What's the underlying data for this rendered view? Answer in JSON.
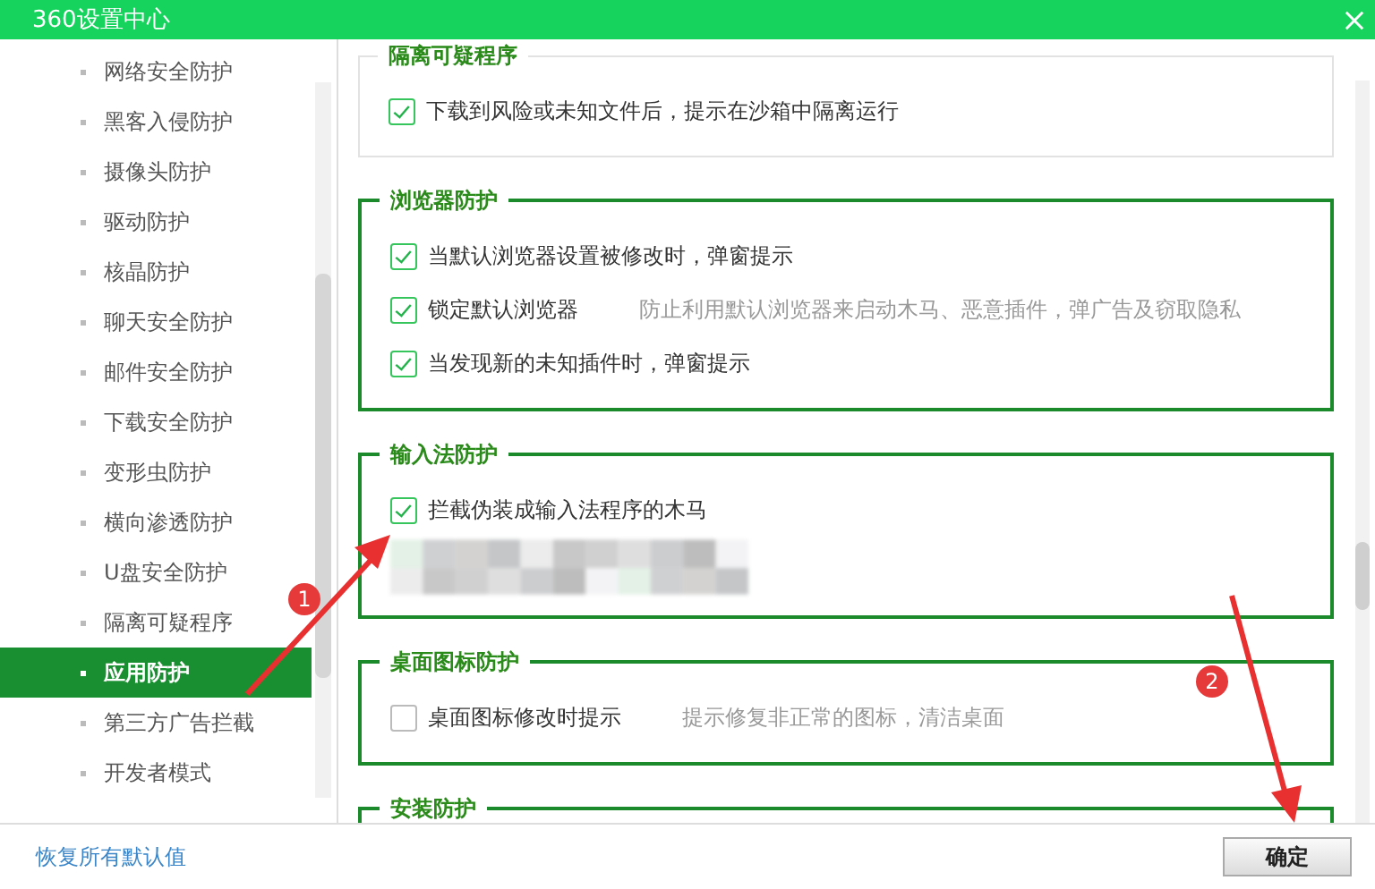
{
  "window": {
    "title": "360设置中心"
  },
  "sidebar": {
    "items": [
      {
        "label": "网络安全防护",
        "selected": false
      },
      {
        "label": "黑客入侵防护",
        "selected": false
      },
      {
        "label": "摄像头防护",
        "selected": false
      },
      {
        "label": "驱动防护",
        "selected": false
      },
      {
        "label": "核晶防护",
        "selected": false
      },
      {
        "label": "聊天安全防护",
        "selected": false
      },
      {
        "label": "邮件安全防护",
        "selected": false
      },
      {
        "label": "下载安全防护",
        "selected": false
      },
      {
        "label": "变形虫防护",
        "selected": false
      },
      {
        "label": "横向渗透防护",
        "selected": false
      },
      {
        "label": "U盘安全防护",
        "selected": false
      },
      {
        "label": "隔离可疑程序",
        "selected": false
      },
      {
        "label": "应用防护",
        "selected": true
      },
      {
        "label": "第三方广告拦截",
        "selected": false
      },
      {
        "label": "开发者模式",
        "selected": false
      }
    ]
  },
  "sections": [
    {
      "title": "隔离可疑程序",
      "highlighted": false,
      "options": [
        {
          "kind": "checkbox",
          "label": "下载到风险或未知文件后，提示在沙箱中隔离运行",
          "checked": true
        }
      ]
    },
    {
      "title": "浏览器防护",
      "highlighted": true,
      "options": [
        {
          "kind": "checkbox",
          "label": "当默认浏览器设置被修改时，弹窗提示",
          "checked": true
        },
        {
          "kind": "checkbox",
          "label": "锁定默认浏览器",
          "checked": true,
          "hint": "防止利用默认浏览器来启动木马、恶意插件，弹广告及窃取隐私"
        },
        {
          "kind": "checkbox",
          "label": "当发现新的未知插件时，弹窗提示",
          "checked": true
        }
      ]
    },
    {
      "title": "输入法防护",
      "highlighted": true,
      "options": [
        {
          "kind": "checkbox",
          "label": "拦截伪装成输入法程序的木马",
          "checked": true
        },
        {
          "kind": "redacted"
        }
      ]
    },
    {
      "title": "桌面图标防护",
      "highlighted": true,
      "options": [
        {
          "kind": "checkbox",
          "label": "桌面图标修改时提示",
          "checked": false,
          "hint": "提示修复非正常的图标，清洁桌面"
        }
      ]
    },
    {
      "title": "安装防护",
      "highlighted": true
    }
  ],
  "footer": {
    "reset_link": "恢复所有默认值",
    "ok_button": "确定"
  },
  "annotations": [
    {
      "number": "1"
    },
    {
      "number": "2"
    }
  ]
}
